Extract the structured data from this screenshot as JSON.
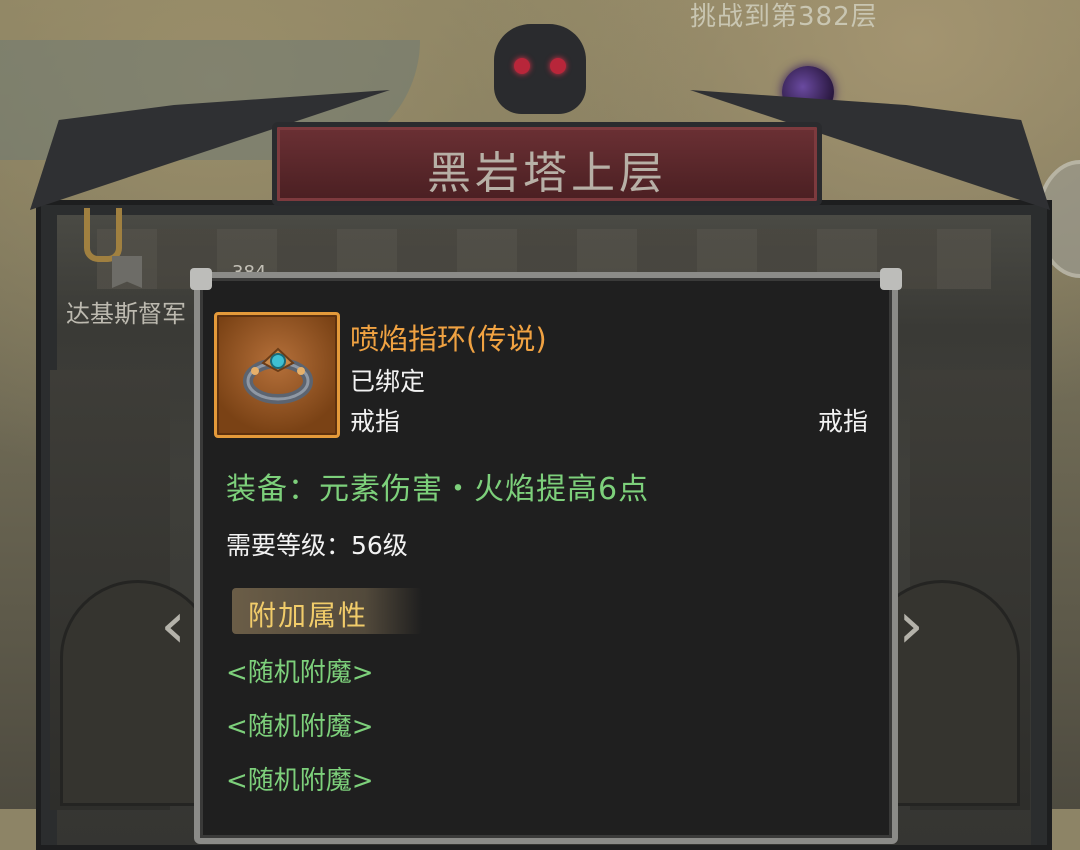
{
  "header": {
    "challenge_text": "挑战到第382层",
    "tower_title": "黑岩塔上层"
  },
  "floor": {
    "label": "达基斯督军",
    "number": "384"
  },
  "tooltip": {
    "item_name": "喷焰指环(传说)",
    "bound_status": "已绑定",
    "slot_type_left": "戒指",
    "slot_type_right": "戒指",
    "equip_effect": "装备：元素伤害・火焰提高6点",
    "required_level": "需要等级：56级",
    "section_title": "附加属性",
    "affixes": [
      "<随机附魔>",
      "<随机附魔>",
      "<随机附魔>"
    ]
  },
  "colors": {
    "item_name": "#f0a242",
    "equip_effect": "#7dd07b",
    "section_title": "#f1cc6a",
    "banner": "#6b3034"
  },
  "icons": {
    "item": "ring-icon",
    "prev": "chevron-left-icon",
    "next": "chevron-right-icon",
    "flag": "flag-icon"
  }
}
